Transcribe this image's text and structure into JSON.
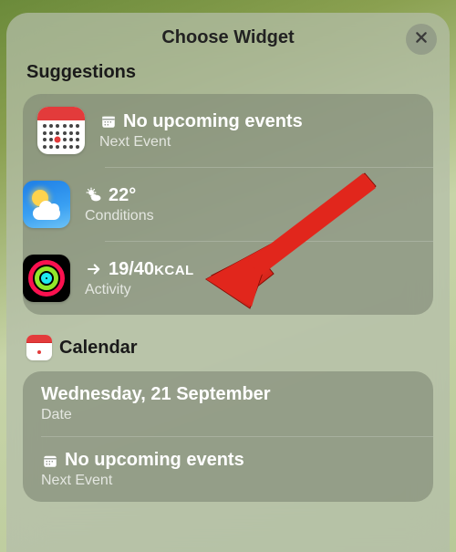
{
  "header": {
    "title": "Choose Widget",
    "close_label": "Close"
  },
  "sections": {
    "suggestions": {
      "title": "Suggestions",
      "items": [
        {
          "title": "No upcoming events",
          "subtitle": "Next Event"
        },
        {
          "title": "22°",
          "subtitle": "Conditions"
        },
        {
          "title": "19/40",
          "unit": "KCAL",
          "subtitle": "Activity"
        }
      ]
    },
    "calendar": {
      "title": "Calendar",
      "items": [
        {
          "title": "Wednesday, 21 September",
          "subtitle": "Date"
        },
        {
          "title": "No upcoming events",
          "subtitle": "Next Event"
        }
      ]
    }
  }
}
